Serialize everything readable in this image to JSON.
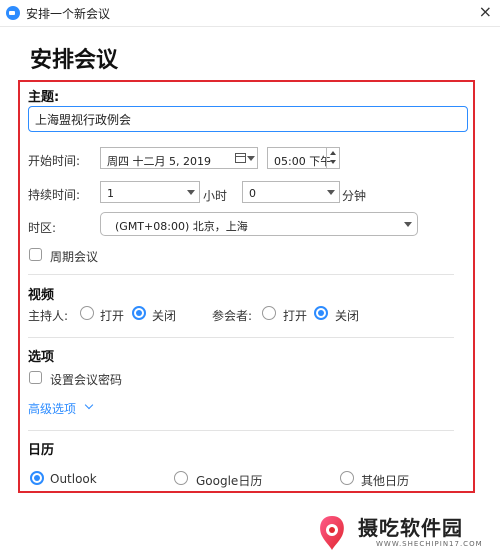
{
  "window": {
    "title": "安排一个新会议"
  },
  "heading": "安排会议",
  "topic": {
    "label": "主题:",
    "value": "上海盟视行政例会"
  },
  "start": {
    "label": "开始时间:",
    "date": "周四  十二月   5, 2019",
    "time": "05:00 下午"
  },
  "duration": {
    "label": "持续时间:",
    "hours": "1",
    "hours_unit": "小时",
    "minutes": "0",
    "minutes_unit": "分钟"
  },
  "timezone": {
    "label": "时区:",
    "value": "(GMT+08:00) 北京，上海"
  },
  "recurring": {
    "label": "周期会议"
  },
  "video": {
    "title": "视频",
    "host_label": "主持人:",
    "participants_label": "参会者:",
    "on_label": "打开",
    "off_label": "关闭"
  },
  "options": {
    "title": "选项",
    "password_label": "设置会议密码",
    "advanced_label": "高级选项"
  },
  "calendar": {
    "title": "日历",
    "outlook": "Outlook",
    "google": "Google日历",
    "other": "其他日历"
  },
  "watermark": {
    "text": "摄吃软件园",
    "sub": "WWW.SHECHIPIN17.COM"
  },
  "colors": {
    "accent": "#2d8cff",
    "highlight_frame": "#e0282f"
  }
}
